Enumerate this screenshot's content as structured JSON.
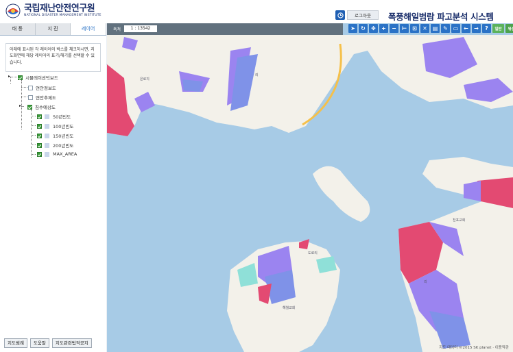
{
  "header": {
    "org_name": "국립재난안전연구원",
    "org_sub": "NATIONAL DISASTER MANAGEMENT INSTITUTE",
    "login_label": "로그아웃",
    "system_title": "폭풍해일범람 파고분석 시스템"
  },
  "left_panel": {
    "tabs": [
      {
        "label": "태 풍",
        "active": false
      },
      {
        "label": "지 진",
        "active": false
      },
      {
        "label": "레이어",
        "active": true
      }
    ],
    "description": "아래에 표시된 각 레이어의 박스를 체크하시면, 지도화면에 해당 레이어의 표기/해기를 선택할 수 있습니다.",
    "layers": [
      {
        "label": "시뮬레이션빅보드",
        "checked": true
      },
      {
        "label": "연안정보도",
        "checked": false
      },
      {
        "label": "연안추제도",
        "checked": false
      },
      {
        "label": "침수예상도",
        "checked": true
      },
      {
        "label": "50년빈도",
        "checked": true
      },
      {
        "label": "100년빈도",
        "checked": true
      },
      {
        "label": "150년빈도",
        "checked": true
      },
      {
        "label": "200년빈도",
        "checked": true
      },
      {
        "label": "MAX_AREA",
        "checked": true
      }
    ],
    "bottom_buttons": [
      "지도범례",
      "도움말",
      "지도관련법적공지"
    ]
  },
  "map": {
    "scale_label": "축척",
    "scale_value": "1 : 13542",
    "tools": [
      "pointer",
      "refresh",
      "pan",
      "zoom-in",
      "zoom-out",
      "measure-distance",
      "measure-area",
      "clear",
      "print",
      "draw",
      "edit",
      "prev",
      "next",
      "help"
    ],
    "tool_text_buttons": [
      "일반",
      "위성"
    ],
    "places": [
      "은로지",
      "리",
      "천포교회",
      "도로리",
      "해월교회",
      "리"
    ],
    "attribution": "지도 데이터 ©2015 SK planet · 이용약관",
    "colors": {
      "sea": "#a7cbe6",
      "land": "#f3f1ea",
      "flood_purple": "#9b84f0",
      "flood_blue": "#7f92e8",
      "flood_red": "#e34a72",
      "flood_cyan": "#8fe0d8",
      "road": "#f5c04a"
    }
  }
}
